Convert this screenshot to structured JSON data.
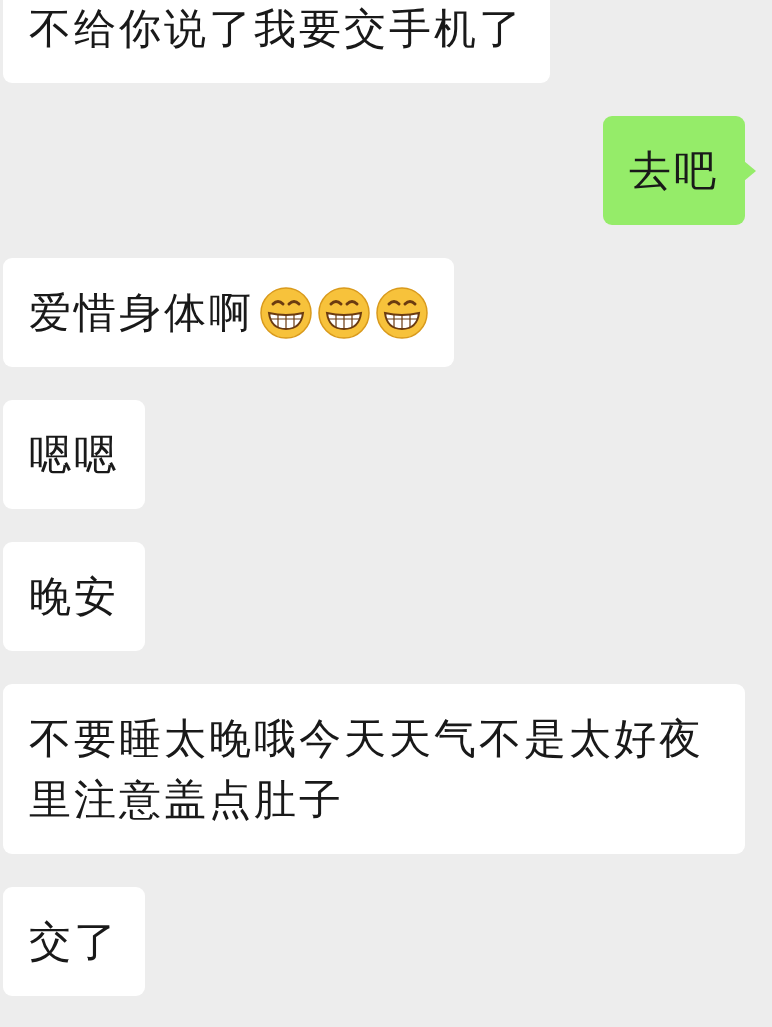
{
  "messages": [
    {
      "kind": "received",
      "text": "不给你说了我要交手机了"
    },
    {
      "kind": "sent",
      "text": "去吧"
    },
    {
      "kind": "received",
      "text": "爱惜身体啊",
      "emojis": [
        {
          "kind": "grin"
        },
        {
          "kind": "grin"
        },
        {
          "kind": "grin"
        }
      ]
    },
    {
      "kind": "received",
      "text": "嗯嗯"
    },
    {
      "kind": "received",
      "text": "晚安"
    },
    {
      "kind": "received",
      "text": "不要睡太晚哦今天天气不是太好夜里注意盖点肚子"
    },
    {
      "kind": "received",
      "text": "交了"
    }
  ]
}
